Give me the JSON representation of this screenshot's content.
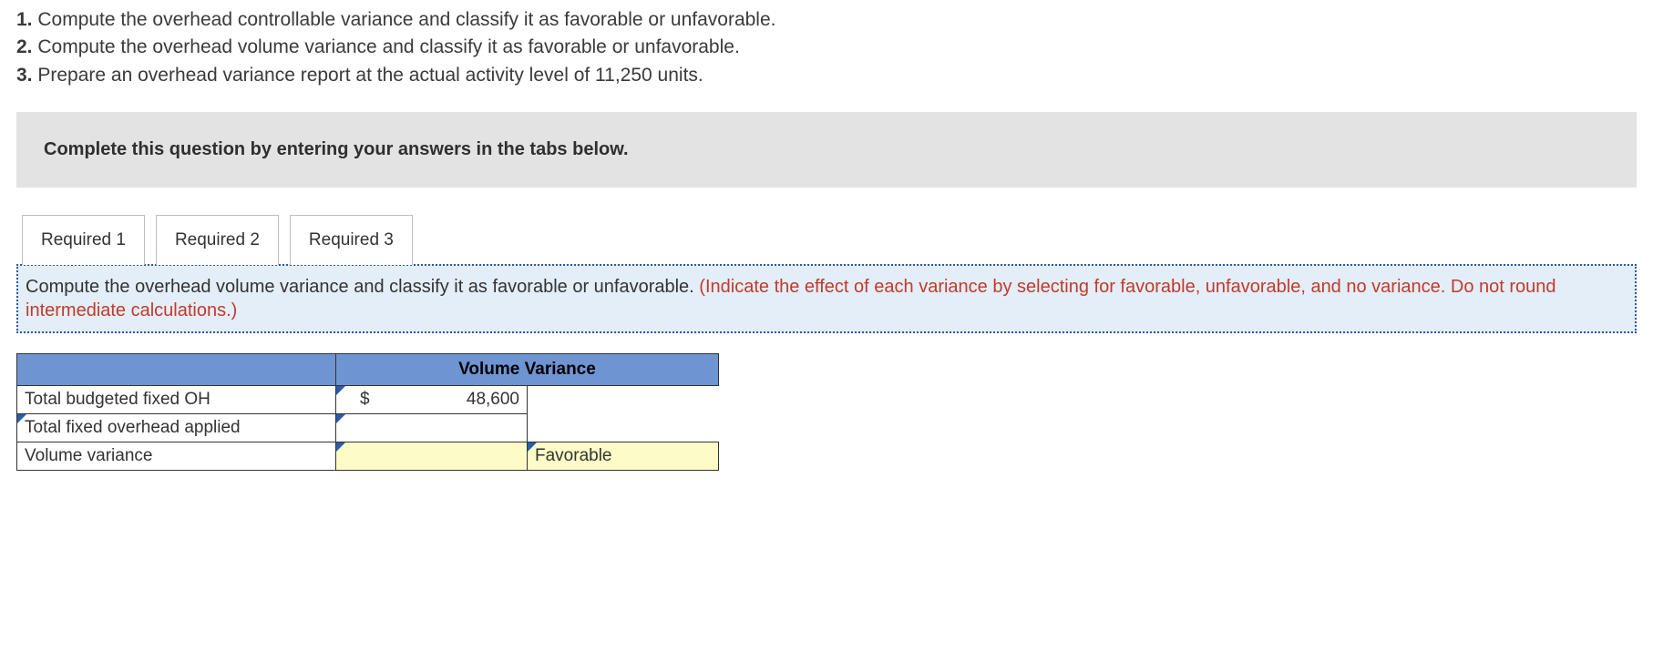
{
  "questions": [
    {
      "num": "1.",
      "text": "Compute the overhead controllable variance and classify it as favorable or unfavorable."
    },
    {
      "num": "2.",
      "text": "Compute the overhead volume variance and classify it as favorable or unfavorable."
    },
    {
      "num": "3.",
      "text": "Prepare an overhead variance report at the actual activity level of 11,250 units."
    }
  ],
  "banner": "Complete this question by entering your answers in the tabs below.",
  "tabs": [
    {
      "label": "Required 1",
      "active": false
    },
    {
      "label": "Required 2",
      "active": true
    },
    {
      "label": "Required 3",
      "active": false
    }
  ],
  "panel": {
    "main": "Compute the overhead volume variance and classify it as favorable or unfavorable. ",
    "hint": "(Indicate the effect of each variance by selecting for favorable, unfavorable, and no variance. Do not round intermediate calculations.)"
  },
  "table": {
    "header": "Volume Variance",
    "rows": [
      {
        "label": "Total budgeted fixed OH",
        "dollar": "$",
        "amount": "48,600",
        "classify": "",
        "labelTick": false,
        "amountTick": true,
        "classifyShown": false,
        "yellow": false
      },
      {
        "label": "Total fixed overhead applied",
        "dollar": "",
        "amount": "",
        "classify": "",
        "labelTick": true,
        "amountTick": true,
        "classifyShown": false,
        "yellow": false
      },
      {
        "label": "Volume variance",
        "dollar": "",
        "amount": "",
        "classify": "Favorable",
        "labelTick": false,
        "amountTick": true,
        "classifyShown": true,
        "yellow": true
      }
    ]
  }
}
